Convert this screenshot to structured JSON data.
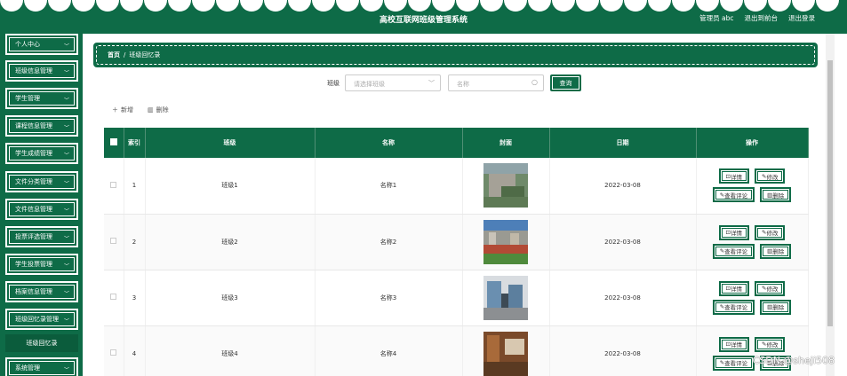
{
  "header": {
    "title": "高校互联网班级管理系统",
    "user_label": "管理员 abc",
    "go_front_label": "退出到前台",
    "logout_label": "退出登录"
  },
  "sidebar": {
    "items": [
      {
        "label": "个人中心"
      },
      {
        "label": "班级信息管理"
      },
      {
        "label": "学生管理"
      },
      {
        "label": "课程信息管理"
      },
      {
        "label": "学生成绩管理"
      },
      {
        "label": "文件分类管理"
      },
      {
        "label": "文件信息管理"
      },
      {
        "label": "投票评选管理"
      },
      {
        "label": "学生投票管理"
      },
      {
        "label": "档案信息管理"
      },
      {
        "label": "班级回忆录管理"
      },
      {
        "label": "系统管理"
      }
    ],
    "active_sub": "班级回忆录"
  },
  "breadcrumb": {
    "home": "首页",
    "separator": "/",
    "current": "班级回忆录"
  },
  "search": {
    "class_label": "班级",
    "class_placeholder": "请选择班级",
    "name_placeholder": "名称",
    "query_label": "查询"
  },
  "toolbar": {
    "add_label": "新增",
    "delete_label": "删除"
  },
  "table": {
    "headers": {
      "index": "索引",
      "class": "班级",
      "name": "名称",
      "cover": "封面",
      "date": "日期",
      "ops": "操作"
    },
    "rows": [
      {
        "index": "1",
        "class": "班级1",
        "name": "名称1",
        "date": "2022-03-08"
      },
      {
        "index": "2",
        "class": "班级2",
        "name": "名称2",
        "date": "2022-03-08"
      },
      {
        "index": "3",
        "class": "班级3",
        "name": "名称3",
        "date": "2022-03-08"
      },
      {
        "index": "4",
        "class": "班级4",
        "name": "名称4",
        "date": "2022-03-08"
      }
    ],
    "op_labels": {
      "detail": "详情",
      "edit": "修改",
      "comments": "查看评论",
      "delete": "删除"
    }
  },
  "watermark": "CSDN @sheji508",
  "colors": {
    "primary": "#0e6b47"
  },
  "icons": {
    "chevron": "chevron-down-icon",
    "search": "search-icon",
    "add": "plus-icon",
    "delete": "trash-icon"
  }
}
